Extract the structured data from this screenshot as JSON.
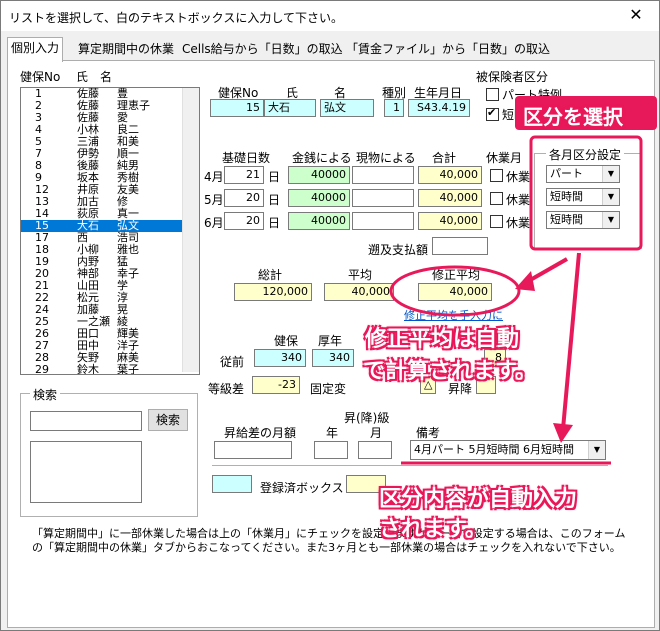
{
  "window": {
    "title": "リストを選択して、白のテキストボックスに入力して下さい。",
    "close": "✕"
  },
  "tabs": [
    "個別入力",
    "算定期間中の休業",
    "Cells給与から「日数」の取込",
    "「賃金ファイル」から「日数」の取込"
  ],
  "list": {
    "header_no": "健保No",
    "header_name": "氏　名",
    "rows": [
      {
        "no": "1",
        "sei": "佐藤",
        "mei": "豊"
      },
      {
        "no": "2",
        "sei": "佐藤",
        "mei": "理恵子"
      },
      {
        "no": "3",
        "sei": "佐藤",
        "mei": "愛"
      },
      {
        "no": "4",
        "sei": "小林",
        "mei": "良二"
      },
      {
        "no": "5",
        "sei": "三浦",
        "mei": "和美"
      },
      {
        "no": "7",
        "sei": "伊勢",
        "mei": "順一"
      },
      {
        "no": "8",
        "sei": "後藤",
        "mei": "純男"
      },
      {
        "no": "9",
        "sei": "坂本",
        "mei": "秀樹"
      },
      {
        "no": "12",
        "sei": "井原",
        "mei": "友美"
      },
      {
        "no": "13",
        "sei": "加古",
        "mei": "修"
      },
      {
        "no": "14",
        "sei": "荻原",
        "mei": "真一"
      },
      {
        "no": "15",
        "sei": "大石",
        "mei": "弘文"
      },
      {
        "no": "17",
        "sei": "西",
        "mei": "浩司"
      },
      {
        "no": "18",
        "sei": "小柳",
        "mei": "雅也"
      },
      {
        "no": "19",
        "sei": "内野",
        "mei": "猛"
      },
      {
        "no": "20",
        "sei": "神部",
        "mei": "幸子"
      },
      {
        "no": "21",
        "sei": "山田",
        "mei": "学"
      },
      {
        "no": "22",
        "sei": "松元",
        "mei": "淳"
      },
      {
        "no": "24",
        "sei": "加藤",
        "mei": "晃"
      },
      {
        "no": "25",
        "sei": "一之瀬",
        "mei": "綾"
      },
      {
        "no": "26",
        "sei": "田口",
        "mei": "輝美"
      },
      {
        "no": "27",
        "sei": "田中",
        "mei": "洋子"
      },
      {
        "no": "28",
        "sei": "矢野",
        "mei": "麻美"
      },
      {
        "no": "29",
        "sei": "鈴木",
        "mei": "葉子"
      }
    ],
    "selected_index": 11
  },
  "search": {
    "group": "検索",
    "button": "検索",
    "value": ""
  },
  "header_fields": {
    "labels": {
      "kenpo": "健保No",
      "sei": "氏",
      "mei": "名",
      "shubetsu": "種別",
      "birth": "生年月日"
    },
    "kenpo": "15",
    "sei": "大石",
    "mei": "弘文",
    "shubetsu": "1",
    "birth": "S43.4.19"
  },
  "insured": {
    "title": "被保険者区分",
    "part_special": "パート特例",
    "short": "短時"
  },
  "basis": {
    "labels": {
      "days": "基礎日数",
      "cash": "金銭による",
      "goods": "現物による",
      "total": "合計",
      "leave": "休業月"
    },
    "rows": [
      {
        "month": "4月",
        "days": "21",
        "unit": "日",
        "cash": "40000",
        "goods": "",
        "total": "40,000",
        "leave_label": "休業"
      },
      {
        "month": "5月",
        "days": "20",
        "unit": "日",
        "cash": "40000",
        "goods": "",
        "total": "40,000",
        "leave_label": "休業"
      },
      {
        "month": "6月",
        "days": "20",
        "unit": "日",
        "cash": "40000",
        "goods": "",
        "total": "40,000",
        "leave_label": "休業"
      }
    ]
  },
  "monthly_class": {
    "title": "各月区分設定",
    "values": [
      "パート",
      "短時間",
      "短時間"
    ]
  },
  "retro": {
    "label": "遡及支払額",
    "value": ""
  },
  "totals": {
    "labels": {
      "sum": "総計",
      "avg": "平均",
      "adj": "修正平均"
    },
    "sum": "120,000",
    "avg": "40,000",
    "adj": "40,000",
    "manual_link": "修正平均を手入力に"
  },
  "grade": {
    "labels": {
      "kenpo": "健保",
      "kosei": "厚年",
      "prev": "従前",
      "diff": "等級差",
      "fixed": "固定変",
      "up": "昇降"
    },
    "prev_kenpo": "340",
    "prev_kosei": "340",
    "diff": "-23",
    "hidden_val": "8",
    "up_mark": "△"
  },
  "raise": {
    "labels": {
      "amount": "昇給差の月額",
      "title": "昇(降)級",
      "year": "年",
      "month": "月",
      "note": "備考"
    },
    "note_value": "4月パート 5月短時間 6月短時間"
  },
  "legend": {
    "registered": "登録済ボックス"
  },
  "footer": "「算定期間中」に一部休業した場合は上の「休業月」にチェックを設定しますが、一括で設定する場合は、このフォームの「算定期間中の休業」タブからおこなってください。また3ヶ月とも一部休業の場合はチェックを入れないで下さい。",
  "annotations": {
    "select": "区分を選択",
    "auto_calc_1": "修正平均は自動",
    "auto_calc_2": "で計算されます。",
    "auto_input_1": "区分内容が自動入力",
    "auto_input_2": "されます。"
  },
  "colors": {
    "accent": "#e8195a",
    "cyan": "#ccffff",
    "yellow": "#ffffcc",
    "green": "#ccffcc",
    "selection": "#0078d7"
  }
}
